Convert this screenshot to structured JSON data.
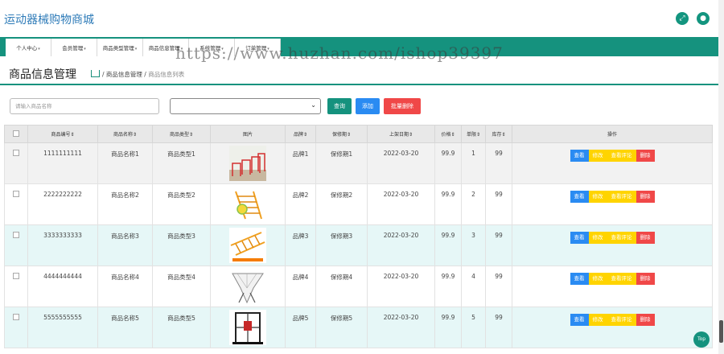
{
  "app": {
    "title": "运动器械购物商城"
  },
  "nav": [
    "个人中心",
    "会员管理",
    "商品类型管理",
    "商品信息管理",
    "系统管理",
    "订单管理"
  ],
  "watermark": "https://www.huzhan.com/ishop39397",
  "page": {
    "title": "商品信息管理",
    "breadcrumb_parent": "商品信息管理",
    "breadcrumb_current": "商品信息列表"
  },
  "search": {
    "placeholder": "请输入商品名称"
  },
  "buttons": {
    "query": "查询",
    "add": "添加",
    "batch_delete": "批量删除"
  },
  "colors": {
    "primary": "#15927e",
    "blue": "#2a8bf2",
    "yellow": "#ffd400",
    "red": "#f04848"
  },
  "table": {
    "headers": [
      "商品编号",
      "商品名称",
      "商品类型",
      "图片",
      "品牌",
      "保修期",
      "上架日期",
      "价格",
      "单限",
      "库存",
      "操作"
    ],
    "actions": [
      "查看",
      "修改",
      "查看评论",
      "删除"
    ],
    "rows": [
      {
        "id": "1111111111",
        "name": "商品名称1",
        "type": "商品类型1",
        "brand": "品牌1",
        "warranty": "保修期1",
        "date": "2022-03-20",
        "price": "99.9",
        "limit": "1",
        "stock": "99"
      },
      {
        "id": "2222222222",
        "name": "商品名称2",
        "type": "商品类型2",
        "brand": "品牌2",
        "warranty": "保修期2",
        "date": "2022-03-20",
        "price": "99.9",
        "limit": "2",
        "stock": "99"
      },
      {
        "id": "3333333333",
        "name": "商品名称3",
        "type": "商品类型3",
        "brand": "品牌3",
        "warranty": "保修期3",
        "date": "2022-03-20",
        "price": "99.9",
        "limit": "3",
        "stock": "99"
      },
      {
        "id": "4444444444",
        "name": "商品名称4",
        "type": "商品类型4",
        "brand": "品牌4",
        "warranty": "保修期4",
        "date": "2022-03-20",
        "price": "99.9",
        "limit": "4",
        "stock": "99"
      },
      {
        "id": "5555555555",
        "name": "商品名称5",
        "type": "商品类型5",
        "brand": "品牌5",
        "warranty": "保修期5",
        "date": "2022-03-20",
        "price": "99.9",
        "limit": "5",
        "stock": "99"
      }
    ]
  },
  "top_button": "Top"
}
